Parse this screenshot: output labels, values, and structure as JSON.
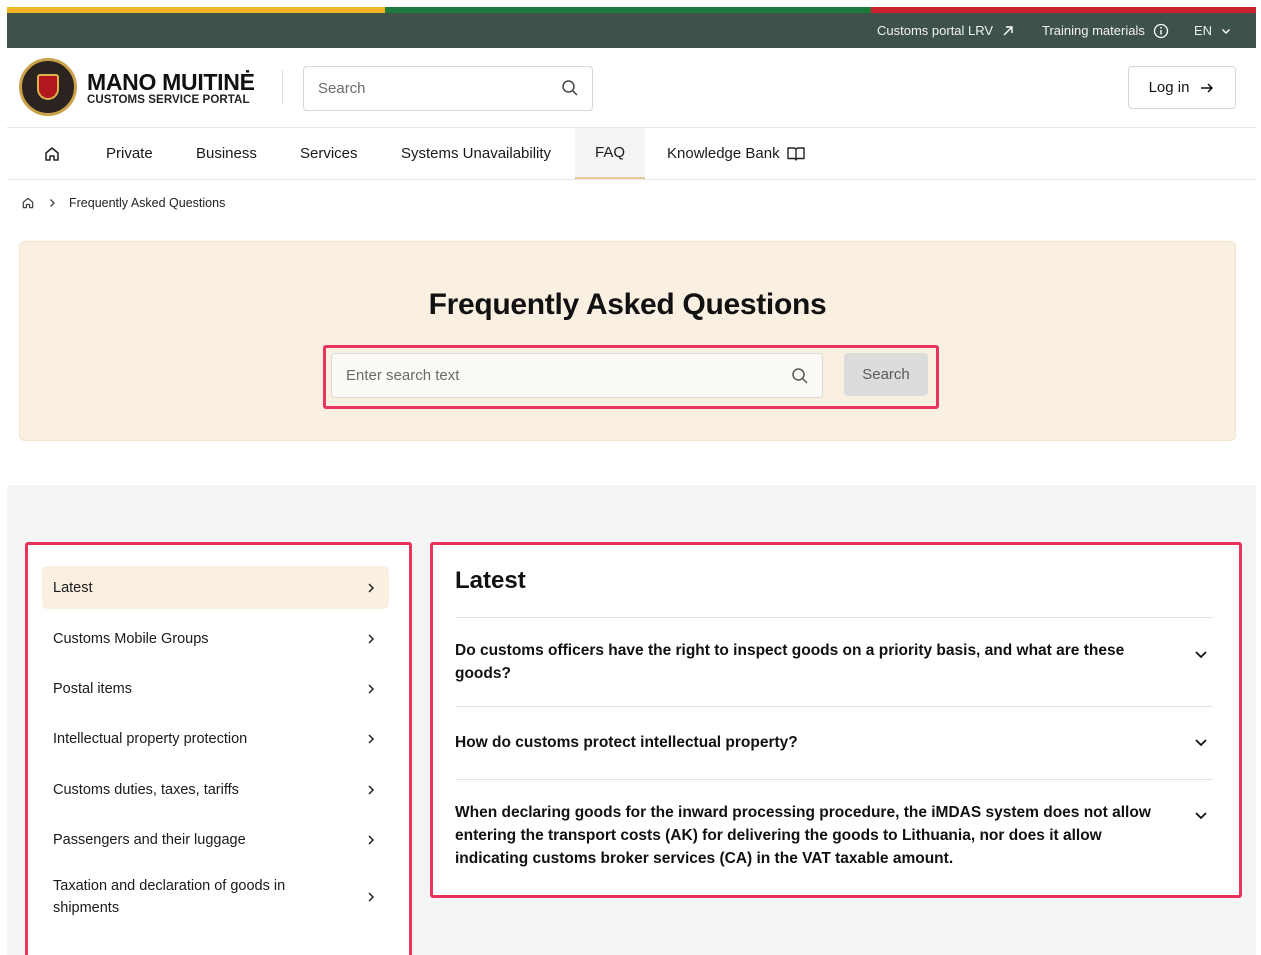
{
  "utility": {
    "portal_label": "Customs portal LRV",
    "training_label": "Training materials",
    "lang_label": "EN"
  },
  "header": {
    "logo_title": "MANO MUITINĖ",
    "logo_subtitle": "CUSTOMS SERVICE PORTAL",
    "search_placeholder": "Search",
    "login_label": "Log in"
  },
  "nav": {
    "items": [
      {
        "label": "Private"
      },
      {
        "label": "Business"
      },
      {
        "label": "Services"
      },
      {
        "label": "Systems Unavailability"
      },
      {
        "label": "FAQ"
      },
      {
        "label": "Knowledge Bank"
      }
    ]
  },
  "breadcrumb": {
    "current": "Frequently Asked Questions"
  },
  "hero": {
    "title": "Frequently Asked Questions",
    "search_placeholder": "Enter search text",
    "search_button": "Search"
  },
  "sidebar": {
    "items": [
      {
        "label": "Latest"
      },
      {
        "label": "Customs Mobile Groups"
      },
      {
        "label": "Postal items"
      },
      {
        "label": "Intellectual property protection"
      },
      {
        "label": "Customs duties, taxes, tariffs"
      },
      {
        "label": "Passengers and their luggage"
      },
      {
        "label": "Taxation and declaration of goods in shipments"
      }
    ]
  },
  "content": {
    "title": "Latest",
    "questions": [
      {
        "text": "Do customs officers have the right to inspect goods on a priority basis, and what are these goods?"
      },
      {
        "text": "How do customs protect intellectual property?"
      },
      {
        "text": "When declaring goods for the inward processing procedure, the iMDAS system does not allow entering the transport costs (AK) for delivering the goods to Lithuania, nor does it allow indicating customs broker services (CA) in the VAT taxable amount."
      }
    ]
  },
  "colors": {
    "flag_yellow": "#f0b524",
    "flag_green": "#1e7a3c",
    "flag_red": "#c8202c",
    "utility_bar": "#3f5249",
    "accent_beige": "#f9f0e2",
    "highlight_pink": "#e8345a"
  },
  "icons": {
    "portal": "external-arrow-icon",
    "training": "info-icon",
    "lang": "chevron-down-icon",
    "search": "search-icon",
    "login": "arrow-right-icon",
    "home": "home-icon",
    "knowledge": "book-icon",
    "sidebar_arrow": "chevron-right-icon",
    "faq_toggle": "chevron-down-icon"
  }
}
